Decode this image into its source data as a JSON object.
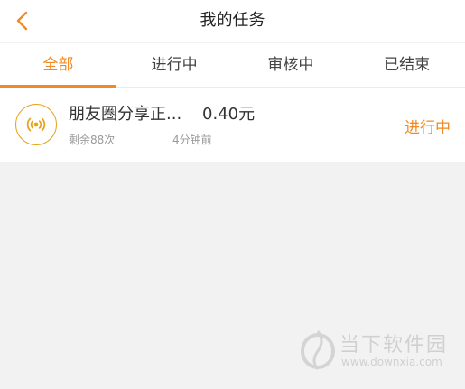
{
  "header": {
    "title": "我的任务",
    "back_icon": "chevron-left-icon",
    "accent_color": "#f08a24"
  },
  "tabs": [
    {
      "label": "全部",
      "active": true
    },
    {
      "label": "进行中",
      "active": false
    },
    {
      "label": "审核中",
      "active": false
    },
    {
      "label": "已结束",
      "active": false
    }
  ],
  "tasks": [
    {
      "icon": "share-signal-icon",
      "title": "朋友圈分享正...",
      "price": "0.40元",
      "remaining": "剩余88次",
      "time": "4分钟前",
      "status": "进行中",
      "status_color": "#f08a24"
    }
  ],
  "watermark": {
    "text": "当下软件园",
    "url": "www.downxia.com"
  }
}
